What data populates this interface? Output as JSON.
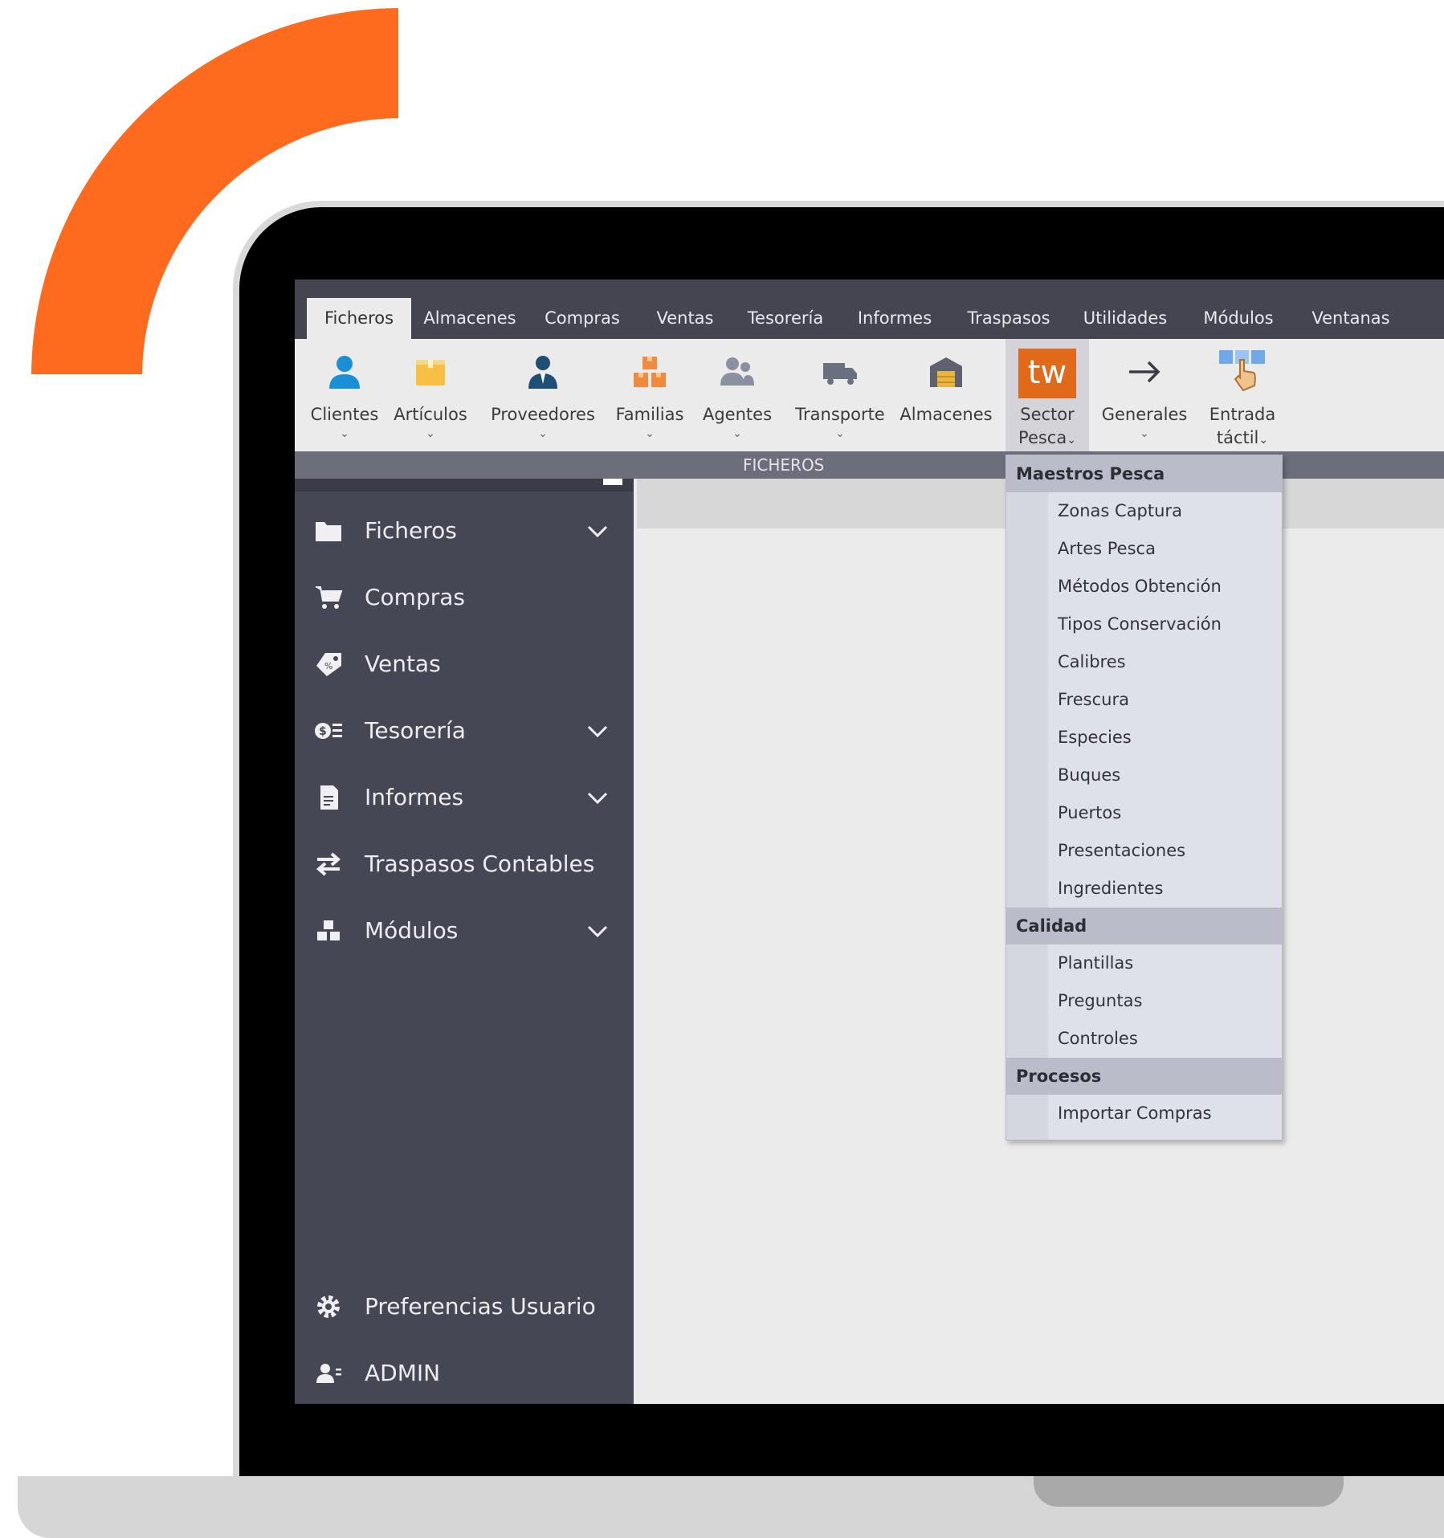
{
  "colors": {
    "accent": "#ff6b1e",
    "sidebar": "#464755",
    "ribbon_tabs": "#454552",
    "menu_header": "#babcca"
  },
  "ribbon": {
    "tabs": [
      "Ficheros",
      "Almacenes",
      "Compras",
      "Ventas",
      "Tesorería",
      "Informes",
      "Traspasos",
      "Utilidades",
      "Módulos",
      "Ventanas"
    ],
    "buttons": {
      "clientes": "Clientes",
      "articulos": "Artículos",
      "proveedores": "Proveedores",
      "familias": "Familias",
      "agentes": "Agentes",
      "transporte": "Transporte",
      "almacenes": "Almacenes",
      "sector_line1": "Sector",
      "sector_line2": "Pesca",
      "sector_logo": "tw",
      "generales": "Generales",
      "entrada_line1": "Entrada",
      "entrada_line2": "táctil"
    },
    "chevron": "⌄",
    "group_label": "FICHEROS"
  },
  "sidebar": {
    "items": [
      {
        "label": "Ficheros",
        "icon": "folder-icon",
        "expandable": true
      },
      {
        "label": "Compras",
        "icon": "cart-icon",
        "expandable": false
      },
      {
        "label": "Ventas",
        "icon": "tag-icon",
        "expandable": false
      },
      {
        "label": "Tesorería",
        "icon": "money-icon",
        "expandable": true
      },
      {
        "label": "Informes",
        "icon": "report-icon",
        "expandable": true
      },
      {
        "label": "Traspasos Contables",
        "icon": "transfer-icon",
        "expandable": false
      },
      {
        "label": "Módulos",
        "icon": "modules-icon",
        "expandable": true
      }
    ],
    "bottom": {
      "preferences": "Preferencias Usuario",
      "user": "ADMIN"
    }
  },
  "menu": {
    "sections": [
      {
        "header": "Maestros Pesca",
        "items": [
          "Zonas Captura",
          "Artes Pesca",
          "Métodos Obtención",
          "Tipos Conservación",
          "Calibres",
          "Frescura",
          "Especies",
          "Buques",
          "Puertos",
          "Presentaciones",
          "Ingredientes"
        ]
      },
      {
        "header": "Calidad",
        "items": [
          "Plantillas",
          "Preguntas",
          "Controles"
        ]
      },
      {
        "header": "Procesos",
        "items": [
          "Importar Compras"
        ]
      }
    ]
  }
}
